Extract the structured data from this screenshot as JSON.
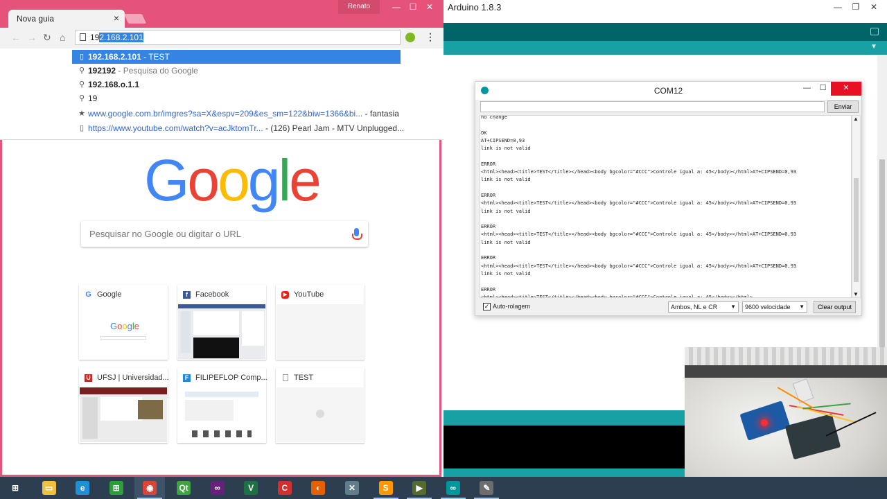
{
  "browser": {
    "tab_title": "Nova guia",
    "tab_close": "×",
    "window_user": "Renato",
    "window_buttons": [
      "—",
      "☐",
      "✕"
    ],
    "address_typed": "19",
    "address_selected": "2.168.2.101",
    "suggestions": [
      {
        "icon": "page",
        "bold": "192.168.2.101",
        "rest": " - TEST"
      },
      {
        "icon": "search",
        "bold": "192192",
        "rest": " - Pesquisa do Google"
      },
      {
        "icon": "search",
        "bold": "192.168.o.1.1",
        "rest": ""
      },
      {
        "icon": "search",
        "bold": "19",
        "rest": ""
      },
      {
        "icon": "star",
        "link": "www.google.com.br/imgres?sa=X&espv=209&es_sm=122&biw=1366&bi...",
        "rest": " - fantasia"
      },
      {
        "icon": "page",
        "link": "https://www.youtube.com/watch?v=acJktomTr...",
        "rest": " - (126) Pearl Jam - MTV Unplugged..."
      }
    ],
    "ntp": {
      "logo": "Google",
      "search_placeholder": "Pesquisar no Google ou digitar o URL",
      "tiles": [
        {
          "title": "Google",
          "icon_color": "#4285f4",
          "icon_text": "G"
        },
        {
          "title": "Facebook",
          "icon_color": "#3b5998",
          "icon_text": "f"
        },
        {
          "title": "YouTube",
          "icon_color": "#e62117",
          "icon_text": "▶"
        },
        {
          "title": "UFSJ | Universidad...",
          "icon_color": "#c62828",
          "icon_text": "U"
        },
        {
          "title": "FILIPEFLOP Comp...",
          "icon_color": "#1e88e5",
          "icon_text": "F"
        },
        {
          "title": "TEST",
          "icon_color": "#9e9e9e",
          "icon_text": ""
        }
      ]
    }
  },
  "arduino": {
    "title": "Arduino 1.8.3",
    "window_buttons": [
      "—",
      "❐",
      "✕"
    ],
    "serial": {
      "title": "COM12",
      "window_buttons": [
        "—",
        "☐",
        "✕"
      ],
      "send_label": "Enviar",
      "lines": [
        "no change",
        "",
        "OK",
        "AT+CIPSEND=0,93",
        "link is not valid",
        "",
        "ERROR",
        "<html><head><title>TEST</title></head><body bgcolor=\"#CCC\">Controle igual a: 45</body></html>AT+CIPSEND=0,93",
        "link is not valid",
        "",
        "ERROR",
        "<html><head><title>TEST</title></head><body bgcolor=\"#CCC\">Controle igual a: 45</body></html>AT+CIPSEND=0,93",
        "link is not valid",
        "",
        "ERROR",
        "<html><head><title>TEST</title></head><body bgcolor=\"#CCC\">Controle igual a: 45</body></html>AT+CIPSEND=0,93",
        "link is not valid",
        "",
        "ERROR",
        "<html><head><title>TEST</title></head><body bgcolor=\"#CCC\">Controle igual a: 45</body></html>AT+CIPSEND=0,93",
        "link is not valid",
        "",
        "ERROR",
        "<html><head><title>TEST</title></head><body bgcolor=\"#CCC\">Controle igual a: 45</body></html>"
      ],
      "autoscroll_label": "Auto-rolagem",
      "autoscroll_checked": "✓",
      "line_ending": "Ambos, NL e CR",
      "baud": "9600 velocidade",
      "clear_label": "Clear output"
    }
  },
  "taskbar": {
    "items": [
      {
        "name": "windows-start",
        "color": "#2d3e50",
        "glyph": "⊞"
      },
      {
        "name": "file-explorer",
        "color": "#f0c040",
        "glyph": "▭"
      },
      {
        "name": "internet-explorer",
        "color": "#1e90d6",
        "glyph": "e"
      },
      {
        "name": "store",
        "color": "#2e9e3a",
        "glyph": "⊞"
      },
      {
        "name": "chrome",
        "color": "#db4437",
        "glyph": "◉"
      },
      {
        "name": "qt-creator",
        "color": "#41a33e",
        "glyph": "Qt"
      },
      {
        "name": "visual-studio",
        "color": "#68217a",
        "glyph": "∞"
      },
      {
        "name": "excel-like",
        "color": "#1e7145",
        "glyph": "V"
      },
      {
        "name": "app-red",
        "color": "#d32f2f",
        "glyph": "C"
      },
      {
        "name": "firefox",
        "color": "#e66000",
        "glyph": "◐"
      },
      {
        "name": "tool-x",
        "color": "#607d8b",
        "glyph": "✕"
      },
      {
        "name": "sublime",
        "color": "#ff9800",
        "glyph": "S"
      },
      {
        "name": "terminal",
        "color": "#556b2f",
        "glyph": "▶"
      },
      {
        "name": "arduino",
        "color": "#00979c",
        "glyph": "∞"
      },
      {
        "name": "app-pen",
        "color": "#6d6d6d",
        "glyph": "✎"
      }
    ]
  }
}
